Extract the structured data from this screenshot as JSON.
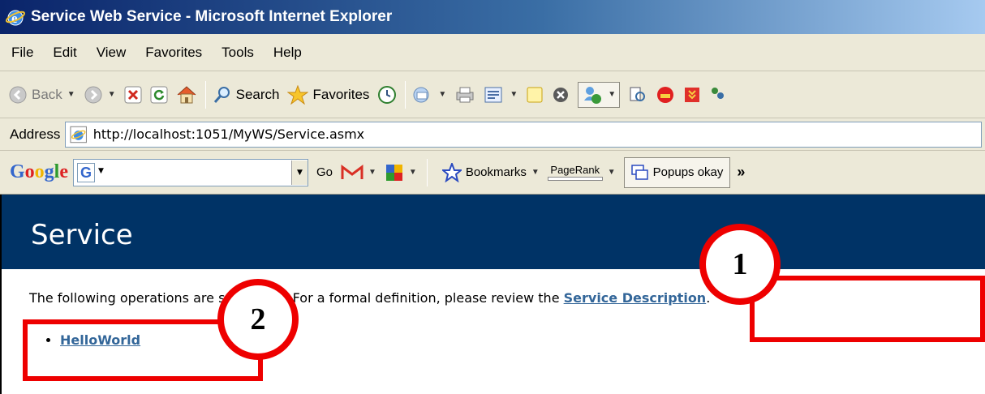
{
  "window": {
    "title": "Service Web Service - Microsoft Internet Explorer"
  },
  "menu": [
    "File",
    "Edit",
    "View",
    "Favorites",
    "Tools",
    "Help"
  ],
  "toolbar": {
    "back_label": "Back",
    "search_label": "Search",
    "favorites_label": "Favorites"
  },
  "address": {
    "label": "Address",
    "url": "http://localhost:1051/MyWS/Service.asmx"
  },
  "google_toolbar": {
    "logo": "Google",
    "search_value": "",
    "go_label": "Go",
    "bookmarks_label": "Bookmarks",
    "pagerank_label": "PageRank",
    "popups_label": "Popups okay",
    "overflow_label": "»"
  },
  "page": {
    "heading": "Service",
    "intro_text": "The following operations are supported. For a formal definition, please review the ",
    "service_description_link": "Service Description",
    "intro_end": ".",
    "operations": [
      "HelloWorld"
    ]
  },
  "annotations": {
    "callout_1": "1",
    "callout_2": "2",
    "color": "#ee0000"
  },
  "colors": {
    "banner": "#003366",
    "link": "#336699",
    "chrome": "#ece9d8",
    "titlebar": "#0a246a"
  }
}
